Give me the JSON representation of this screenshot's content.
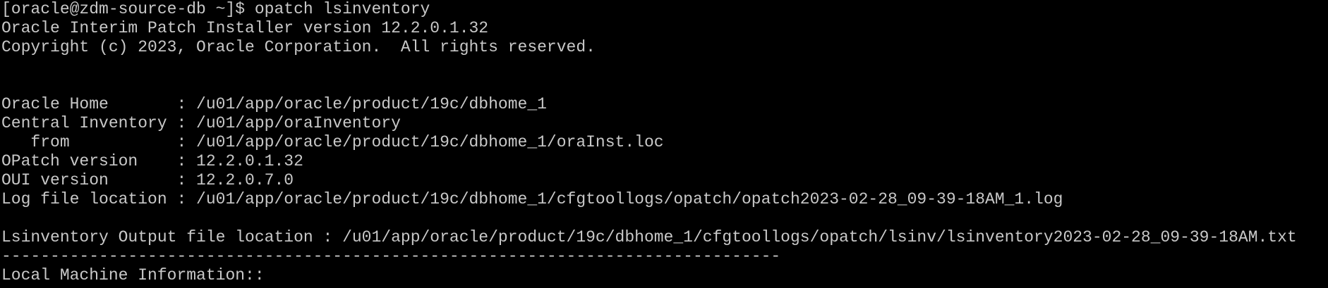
{
  "terminal": {
    "lines": [
      "[oracle@zdm-source-db ~]$ opatch lsinventory",
      "Oracle Interim Patch Installer version 12.2.0.1.32",
      "Copyright (c) 2023, Oracle Corporation.  All rights reserved.",
      "",
      "",
      "Oracle Home       : /u01/app/oracle/product/19c/dbhome_1",
      "Central Inventory : /u01/app/oraInventory",
      "   from           : /u01/app/oracle/product/19c/dbhome_1/oraInst.loc",
      "OPatch version    : 12.2.0.1.32",
      "OUI version       : 12.2.0.7.0",
      "Log file location : /u01/app/oracle/product/19c/dbhome_1/cfgtoollogs/opatch/opatch2023-02-28_09-39-18AM_1.log",
      "",
      "Lsinventory Output file location : /u01/app/oracle/product/19c/dbhome_1/cfgtoollogs/opatch/lsinv/lsinventory2023-02-28_09-39-18AM.txt",
      "--------------------------------------------------------------------------------",
      "Local Machine Information::"
    ]
  }
}
